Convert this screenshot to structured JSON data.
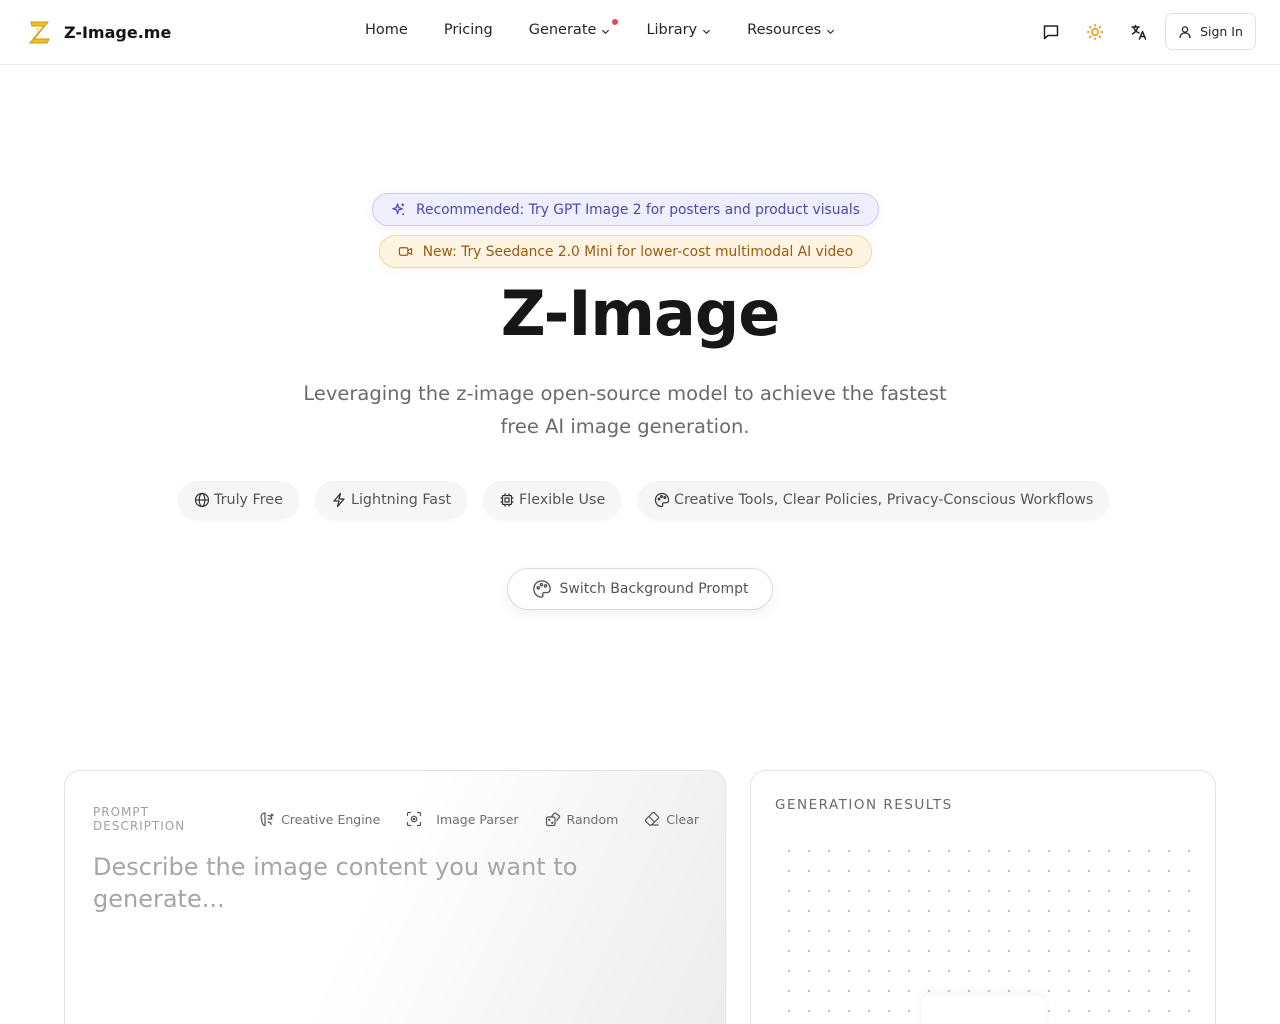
{
  "header": {
    "brand": "Z-Image.me",
    "nav": [
      {
        "label": "Home",
        "dropdown": false
      },
      {
        "label": "Pricing",
        "dropdown": false
      },
      {
        "label": "Generate",
        "dropdown": true,
        "badge": true
      },
      {
        "label": "Library",
        "dropdown": true
      },
      {
        "label": "Resources",
        "dropdown": true
      }
    ],
    "icons": [
      "chat-icon",
      "sun-icon",
      "translate-icon"
    ],
    "sign_in": "Sign In"
  },
  "hero": {
    "recommended": "Recommended: Try GPT Image 2 for posters and product visuals",
    "new_banner": "New: Try Seedance 2.0 Mini for lower-cost multimodal AI video",
    "title": "Z-Image",
    "subtitle": "Leveraging the z-image open-source model to achieve the fastest free AI image generation.",
    "features": [
      {
        "label": "Truly Free",
        "icon": "globe-icon"
      },
      {
        "label": "Lightning Fast",
        "icon": "lightning-icon"
      },
      {
        "label": "Flexible Use",
        "icon": "chip-icon"
      },
      {
        "label": "Creative Tools, Clear Policies, Privacy-Conscious Workflows",
        "icon": "palette-icon"
      }
    ],
    "switch_button": "Switch Background Prompt"
  },
  "prompt": {
    "label": "PROMPT DESCRIPTION",
    "tools": [
      "Creative Engine",
      "Image Parser",
      "Random",
      "Clear"
    ],
    "placeholder": "Describe the image content you want to generate..."
  },
  "results": {
    "title": "GENERATION RESULTS"
  },
  "colors": {
    "recommended_bg": "#efeefc",
    "recommended_text": "#4b49ad",
    "new_bg": "#fdf4e1",
    "new_text": "#9a5a10",
    "badge_red": "#e5484d",
    "logo_yellow": "#f2c21a"
  }
}
